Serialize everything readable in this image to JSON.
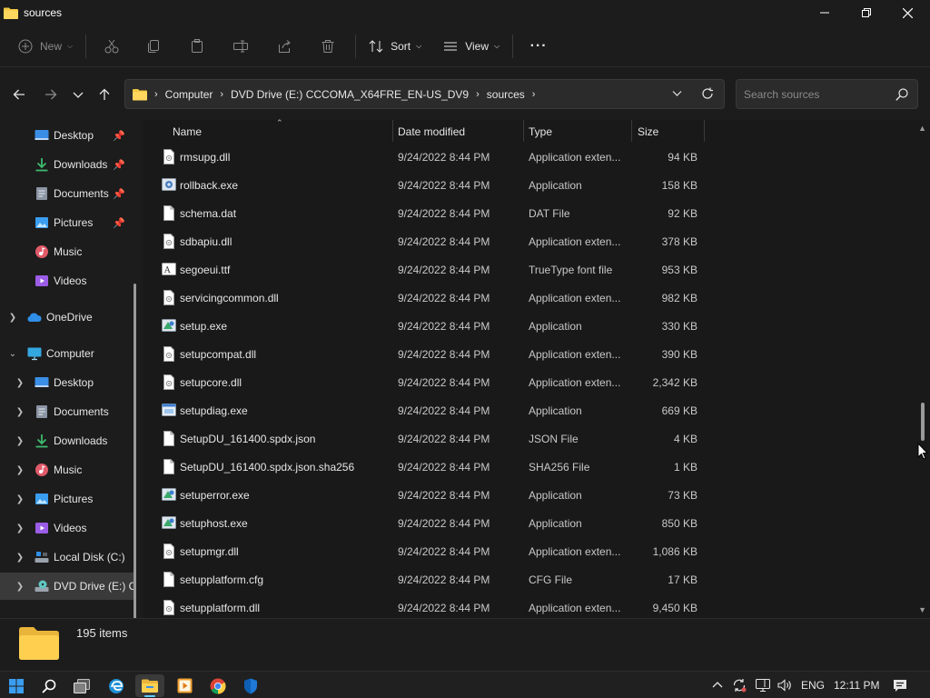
{
  "window": {
    "title": "sources",
    "controls": {
      "minimize_icon": "minimize-icon",
      "maximize_icon": "restore-icon",
      "close_icon": "close-icon"
    }
  },
  "toolbar": {
    "new_label": "New",
    "sort_label": "Sort",
    "view_label": "View",
    "more_label": "···",
    "icons": [
      "cut-icon",
      "copy-icon",
      "paste-icon",
      "rename-icon",
      "share-icon",
      "delete-icon"
    ]
  },
  "address": {
    "crumbs": [
      "Computer",
      "DVD Drive (E:) CCCOMA_X64FRE_EN-US_DV9",
      "sources"
    ],
    "search_placeholder": "Search sources"
  },
  "nav": {
    "items": [
      {
        "label": "Desktop",
        "icon": "desktop-icon",
        "pinned": true
      },
      {
        "label": "Downloads",
        "icon": "download-icon",
        "pinned": true
      },
      {
        "label": "Documents",
        "icon": "documents-icon",
        "pinned": true
      },
      {
        "label": "Pictures",
        "icon": "pictures-icon",
        "pinned": true
      },
      {
        "label": "Music",
        "icon": "music-icon",
        "pinned": false
      },
      {
        "label": "Videos",
        "icon": "videos-icon",
        "pinned": false
      },
      {
        "label": "OneDrive",
        "icon": "cloud-icon"
      },
      {
        "label": "Computer",
        "icon": "computer-icon"
      },
      {
        "label": "Desktop",
        "icon": "desktop-icon"
      },
      {
        "label": "Documents",
        "icon": "documents-icon"
      },
      {
        "label": "Downloads",
        "icon": "download-icon"
      },
      {
        "label": "Music",
        "icon": "music-icon"
      },
      {
        "label": "Pictures",
        "icon": "pictures-icon"
      },
      {
        "label": "Videos",
        "icon": "videos-icon"
      },
      {
        "label": "Local Disk (C:)",
        "icon": "drive-icon"
      },
      {
        "label": "DVD Drive (E:) C",
        "icon": "dvd-icon"
      }
    ]
  },
  "columns": {
    "name": "Name",
    "date": "Date modified",
    "type": "Type",
    "size": "Size"
  },
  "files": [
    {
      "name": "rmsupg.dll",
      "date": "9/24/2022 8:44 PM",
      "type": "Application exten...",
      "size": "94 KB",
      "icon": "dll-file-icon"
    },
    {
      "name": "rollback.exe",
      "date": "9/24/2022 8:44 PM",
      "type": "Application",
      "size": "158 KB",
      "icon": "exe-file-icon"
    },
    {
      "name": "schema.dat",
      "date": "9/24/2022 8:44 PM",
      "type": "DAT File",
      "size": "92 KB",
      "icon": "file-icon"
    },
    {
      "name": "sdbapiu.dll",
      "date": "9/24/2022 8:44 PM",
      "type": "Application exten...",
      "size": "378 KB",
      "icon": "dll-file-icon"
    },
    {
      "name": "segoeui.ttf",
      "date": "9/24/2022 8:44 PM",
      "type": "TrueType font file",
      "size": "953 KB",
      "icon": "font-file-icon"
    },
    {
      "name": "servicingcommon.dll",
      "date": "9/24/2022 8:44 PM",
      "type": "Application exten...",
      "size": "982 KB",
      "icon": "dll-file-icon"
    },
    {
      "name": "setup.exe",
      "date": "9/24/2022 8:44 PM",
      "type": "Application",
      "size": "330 KB",
      "icon": "setup-exe-icon"
    },
    {
      "name": "setupcompat.dll",
      "date": "9/24/2022 8:44 PM",
      "type": "Application exten...",
      "size": "390 KB",
      "icon": "dll-file-icon"
    },
    {
      "name": "setupcore.dll",
      "date": "9/24/2022 8:44 PM",
      "type": "Application exten...",
      "size": "2,342 KB",
      "icon": "dll-file-icon"
    },
    {
      "name": "setupdiag.exe",
      "date": "9/24/2022 8:44 PM",
      "type": "Application",
      "size": "669 KB",
      "icon": "window-exe-icon"
    },
    {
      "name": "SetupDU_161400.spdx.json",
      "date": "9/24/2022 8:44 PM",
      "type": "JSON File",
      "size": "4 KB",
      "icon": "file-icon"
    },
    {
      "name": "SetupDU_161400.spdx.json.sha256",
      "date": "9/24/2022 8:44 PM",
      "type": "SHA256 File",
      "size": "1 KB",
      "icon": "file-icon"
    },
    {
      "name": "setuperror.exe",
      "date": "9/24/2022 8:44 PM",
      "type": "Application",
      "size": "73 KB",
      "icon": "setup-exe-icon"
    },
    {
      "name": "setuphost.exe",
      "date": "9/24/2022 8:44 PM",
      "type": "Application",
      "size": "850 KB",
      "icon": "setup-exe-icon"
    },
    {
      "name": "setupmgr.dll",
      "date": "9/24/2022 8:44 PM",
      "type": "Application exten...",
      "size": "1,086 KB",
      "icon": "dll-file-icon"
    },
    {
      "name": "setupplatform.cfg",
      "date": "9/24/2022 8:44 PM",
      "type": "CFG File",
      "size": "17 KB",
      "icon": "file-icon"
    },
    {
      "name": "setupplatform.dll",
      "date": "9/24/2022 8:44 PM",
      "type": "Application exten...",
      "size": "9,450 KB",
      "icon": "dll-file-icon"
    }
  ],
  "status": {
    "item_count": "195 items"
  },
  "taskbar": {
    "apps": [
      "start-icon",
      "search-icon",
      "task-view-icon",
      "edge-icon",
      "file-explorer-icon",
      "media-player-icon",
      "chrome-icon",
      "defender-icon"
    ],
    "language": "ENG",
    "time": "12:11 PM"
  },
  "colors": {
    "accent": "#60cdff",
    "folder": "#f4c842",
    "background": "#191919"
  }
}
